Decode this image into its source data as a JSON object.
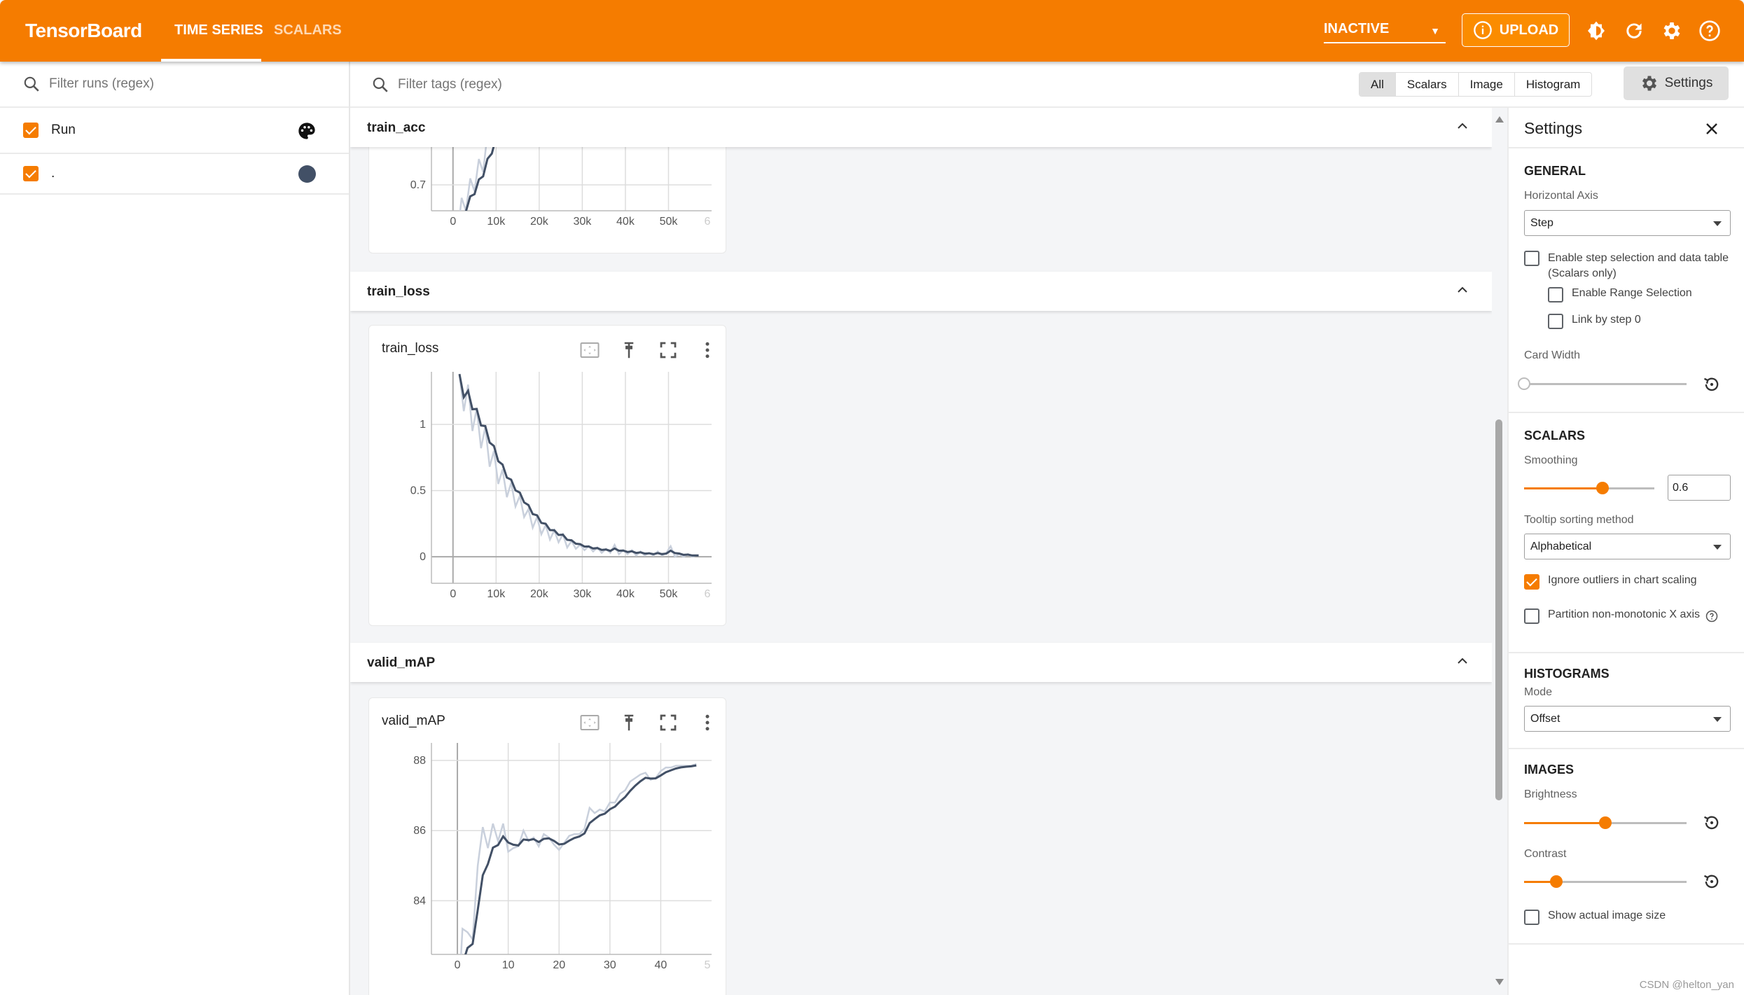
{
  "header": {
    "title": "TensorBoard",
    "tabs": [
      {
        "label": "TIME SERIES",
        "active": true
      },
      {
        "label": "SCALARS",
        "active": false
      }
    ],
    "status_select": "INACTIVE",
    "upload_label": "UPLOAD",
    "icons": [
      "dark-mode-icon",
      "refresh-icon",
      "settings-gear-icon",
      "help-icon"
    ],
    "accent": "#f57c00"
  },
  "sidebar": {
    "filter_placeholder": "Filter runs (regex)",
    "runs": [
      {
        "label": "Run",
        "checked": true,
        "icon": "palette-icon"
      },
      {
        "label": ".",
        "checked": true,
        "color": "#425066"
      }
    ]
  },
  "toolbar": {
    "filter_placeholder": "Filter tags (regex)",
    "types": [
      "All",
      "Scalars",
      "Image",
      "Histogram"
    ],
    "selected_type": "All",
    "settings_label": "Settings"
  },
  "sections": [
    {
      "title": "train_acc"
    },
    {
      "title": "train_loss"
    },
    {
      "title": "valid_mAP"
    }
  ],
  "chart_data": [
    {
      "type": "line",
      "title": "train_acc",
      "x_ticks": [
        "0",
        "10k",
        "20k",
        "30k",
        "40k",
        "50k",
        "6"
      ],
      "y_ticks": [
        "0.7"
      ],
      "xlim": [
        -5000,
        60000
      ],
      "ylim": [
        0.66,
        0.987
      ],
      "grid": true,
      "color": "#425066",
      "smoothing": 0.6,
      "x": [
        1000,
        2000,
        3000,
        4000,
        5000,
        6000,
        7000,
        8000,
        9000,
        10000,
        11000,
        12000
      ],
      "values": [
        0.62,
        0.68,
        0.66,
        0.71,
        0.69,
        0.74,
        0.72,
        0.78,
        0.76,
        0.81,
        0.8,
        0.83
      ]
    },
    {
      "type": "line",
      "title": "train_loss",
      "x_ticks": [
        "0",
        "10k",
        "20k",
        "30k",
        "40k",
        "50k",
        "6"
      ],
      "y_ticks": [
        "0",
        "0.5",
        "1"
      ],
      "xlim": [
        -5000,
        60000
      ],
      "ylim": [
        -0.2,
        1.397
      ],
      "grid": true,
      "color": "#425066",
      "smoothing": 0.6,
      "x": [
        1500,
        2500,
        3500,
        4500,
        5500,
        6500,
        7500,
        8500,
        9500,
        10500,
        11500,
        12500,
        13500,
        14500,
        15500,
        16500,
        17500,
        18500,
        19500,
        20500,
        21500,
        22500,
        23500,
        24500,
        25500,
        26500,
        27500,
        28500,
        29500,
        30500,
        31500,
        32500,
        33500,
        34500,
        35500,
        36500,
        37500,
        38500,
        39500,
        40500,
        41500,
        42500,
        43500,
        44500,
        45500,
        46500,
        47500,
        48500,
        49500,
        50500,
        51500,
        52500,
        53500,
        54500,
        55500,
        56500,
        57000
      ],
      "values": [
        1.38,
        1.1,
        1.3,
        0.95,
        1.12,
        0.82,
        0.98,
        0.68,
        0.8,
        0.55,
        0.66,
        0.45,
        0.56,
        0.38,
        0.46,
        0.3,
        0.36,
        0.22,
        0.3,
        0.17,
        0.24,
        0.13,
        0.2,
        0.11,
        0.17,
        0.07,
        0.12,
        0.06,
        0.09,
        0.05,
        0.08,
        0.04,
        0.07,
        0.03,
        0.06,
        0.03,
        0.09,
        0.02,
        0.05,
        0.02,
        0.05,
        0.01,
        0.04,
        0.01,
        0.03,
        0.01,
        0.04,
        0.01,
        0.03,
        0.08,
        0.0,
        0.02,
        0.0,
        0.02,
        0.0,
        0.01,
        0.01
      ]
    },
    {
      "type": "line",
      "title": "valid_mAP",
      "x_ticks": [
        "0",
        "10",
        "20",
        "30",
        "40",
        "5"
      ],
      "y_ticks": [
        "84",
        "86",
        "88"
      ],
      "xlim": [
        -5.1,
        50
      ],
      "ylim": [
        82.47,
        88.5
      ],
      "grid": true,
      "color": "#425066",
      "smoothing": 0.6,
      "x": [
        0,
        1,
        2,
        3,
        4,
        5,
        6,
        7,
        8,
        9,
        10,
        11,
        12,
        13,
        14,
        15,
        16,
        17,
        18,
        19,
        20,
        21,
        22,
        23,
        24,
        25,
        26,
        27,
        28,
        29,
        30,
        31,
        32,
        33,
        34,
        35,
        36,
        37,
        38,
        39,
        40,
        41,
        42,
        43,
        44,
        45,
        46,
        47
      ],
      "values": [
        80.5,
        83.2,
        83.1,
        82.9,
        85.0,
        86.1,
        85.5,
        86.2,
        85.7,
        86.2,
        85.4,
        85.5,
        85.55,
        86.0,
        85.7,
        85.8,
        85.55,
        85.9,
        85.8,
        85.6,
        85.45,
        85.65,
        85.85,
        85.9,
        85.9,
        86.05,
        86.65,
        86.5,
        86.6,
        86.55,
        86.8,
        86.8,
        87.05,
        87.15,
        87.4,
        87.5,
        87.6,
        87.65,
        87.45,
        87.5,
        87.7,
        87.8,
        87.8,
        87.85,
        87.85,
        87.85,
        87.85,
        87.9
      ]
    }
  ],
  "settings": {
    "title": "Settings",
    "general": {
      "heading": "GENERAL",
      "horizontal_axis_label": "Horizontal Axis",
      "horizontal_axis_value": "Step",
      "step_selection_label": "Enable step selection and data table",
      "step_selection_note": "(Scalars only)",
      "range_selection_label": "Enable Range Selection",
      "link_step0_label": "Link by step 0",
      "card_width_label": "Card Width",
      "card_width_level": 0
    },
    "scalars": {
      "heading": "SCALARS",
      "smoothing_label": "Smoothing",
      "smoothing_value": "0.6",
      "tooltip_label": "Tooltip sorting method",
      "tooltip_value": "Alphabetical",
      "ignore_outliers_label": "Ignore outliers in chart scaling",
      "ignore_outliers": true,
      "partition_label": "Partition non-monotonic X axis",
      "partition": false
    },
    "histograms": {
      "heading": "HISTOGRAMS",
      "mode_label": "Mode",
      "mode_value": "Offset"
    },
    "images": {
      "heading": "IMAGES",
      "brightness_label": "Brightness",
      "brightness_level": 0.5,
      "contrast_label": "Contrast",
      "contrast_level": 0.2,
      "actual_size_label": "Show actual image size",
      "actual_size": false
    }
  },
  "watermark": "CSDN @helton_yan"
}
